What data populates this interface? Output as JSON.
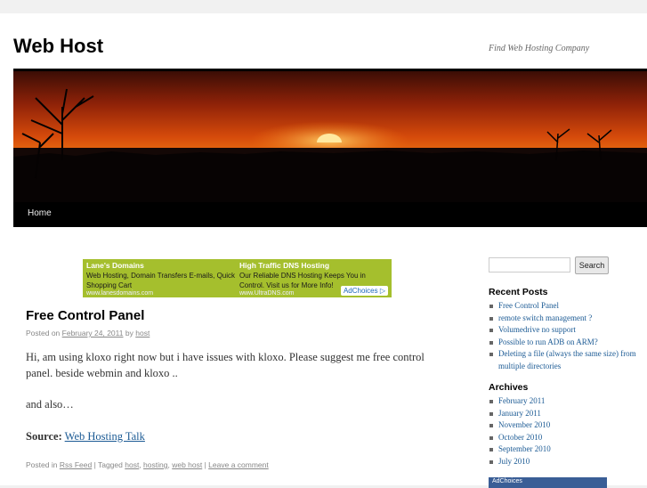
{
  "site": {
    "title": "Web Host",
    "description": "Find Web Hosting Company"
  },
  "nav": {
    "home": "Home"
  },
  "ad": {
    "left": {
      "heading": "Lane's Domains",
      "text": "Web Hosting, Domain Transfers E-mails, Quick Shopping Cart",
      "url": "www.lanesdomains.com"
    },
    "right": {
      "heading": "High Traffic DNS Hosting",
      "text": "Our Reliable DNS Hosting Keeps You in Control. Visit us for More Info!",
      "url": "www.UltraDNS.com"
    },
    "choices": "AdChoices ▷"
  },
  "post": {
    "title": "Free Control Panel",
    "meta_prefix": "Posted on",
    "date": "February 24, 2011",
    "meta_by": "by",
    "author": "host",
    "paragraph1": "Hi, am using kloxo right now but i have issues with kloxo. Please suggest me free control panel. beside webmin and kloxo ..",
    "paragraph2": "and also…",
    "source_label": "Source:",
    "source_link": "Web Hosting Talk",
    "footer": {
      "posted_in": "Posted in",
      "category": "Rss Feed",
      "sep1": " | Tagged ",
      "tags": [
        "host",
        "hosting",
        "web host"
      ],
      "sep2": " | ",
      "comment": "Leave a comment"
    }
  },
  "sidebar": {
    "search_button": "Search",
    "search_value": "",
    "recent_posts_title": "Recent Posts",
    "recent_posts": [
      "Free Control Panel",
      "remote switch management ?",
      "Volumedrive no support",
      "Possible to run ADB on ARM?",
      "Deleting a file (always the same size) from multiple directories"
    ],
    "archives_title": "Archives",
    "archives": [
      "February 2011",
      "January 2011",
      "November 2010",
      "October 2010",
      "September 2010",
      "July 2010"
    ],
    "side_ad_label": "AdChoices"
  },
  "colors": {
    "link": "#1b5a94",
    "ad_background": "#a5bf2d",
    "nav_background": "#000000"
  }
}
